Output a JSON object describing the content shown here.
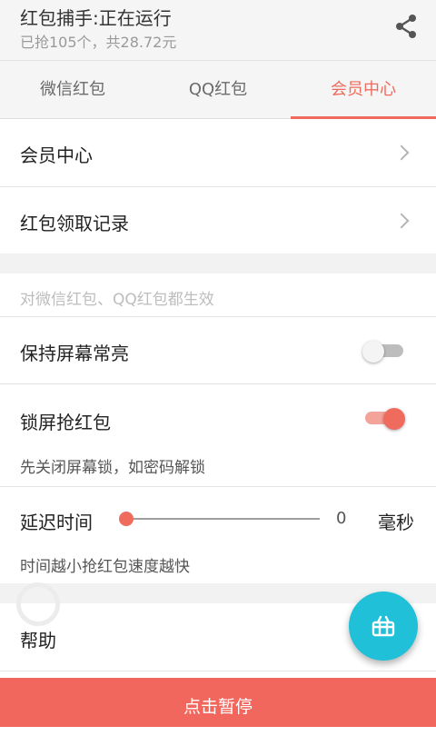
{
  "header": {
    "title": "红包捕手:正在运行",
    "subtitle": "已抢105个，共28.72元",
    "share_icon": "share-icon"
  },
  "tabs": [
    {
      "label": "微信红包",
      "active": false
    },
    {
      "label": "QQ红包",
      "active": false
    },
    {
      "label": "会员中心",
      "active": true
    }
  ],
  "menu": {
    "member_center": "会员中心",
    "records": "红包领取记录"
  },
  "settings": {
    "scope_note": "对微信红包、QQ红包都生效",
    "keep_screen_on": {
      "label": "保持屏幕常亮",
      "enabled": false
    },
    "lockscreen_grab": {
      "label": "锁屏抢红包",
      "enabled": true,
      "hint": "先关闭屏幕锁，如密码解锁"
    },
    "delay": {
      "label": "延迟时间",
      "value": "0",
      "unit": "毫秒",
      "hint": "时间越小抢红包速度越快"
    },
    "help": "帮助"
  },
  "fab": {
    "icon": "gift-box-icon"
  },
  "bottom_action": "点击暂停",
  "colors": {
    "accent": "#ef6b5e",
    "fab": "#1fc0d8",
    "bottom_bar": "#f1675d"
  }
}
